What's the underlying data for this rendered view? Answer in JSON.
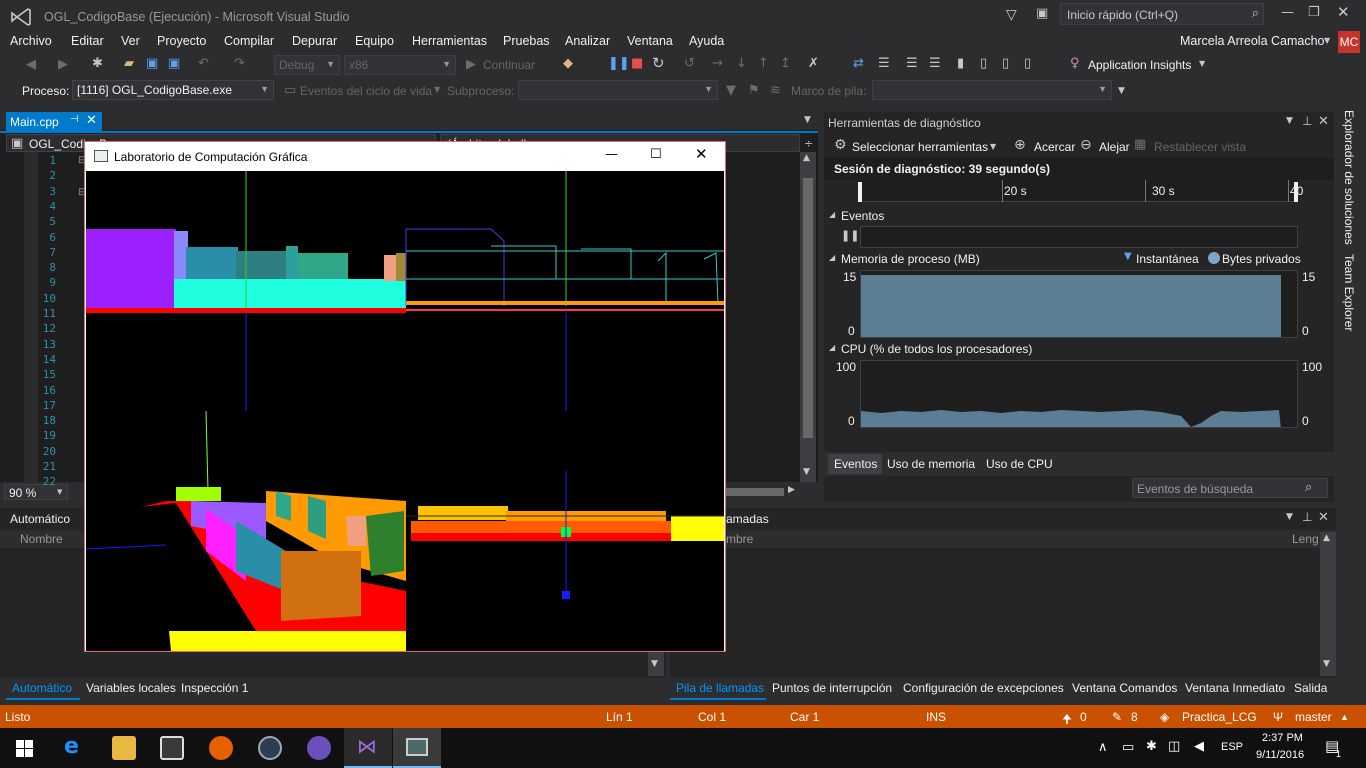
{
  "window": {
    "title": "OGL_CodigoBase (Ejecución) - Microsoft Visual Studio",
    "quick_launch": "Inicio rápido (Ctrl+Q)",
    "user": "Marcela Arreola Camacho",
    "user_initials": "MC"
  },
  "menu": [
    "Archivo",
    "Editar",
    "Ver",
    "Proyecto",
    "Compilar",
    "Depurar",
    "Equipo",
    "Herramientas",
    "Pruebas",
    "Analizar",
    "Ventana",
    "Ayuda"
  ],
  "toolbar": {
    "config": "Debug",
    "platform": "x86",
    "continue": "Continuar",
    "app_insights": "Application Insights"
  },
  "debug_location": {
    "process_label": "Proceso:",
    "process_value": "[1116] OGL_CodigoBase.exe",
    "lifecycle": "Eventos del ciclo de vida",
    "thread_label": "Subproceso:",
    "stack_label": "Marco de pila:"
  },
  "editor": {
    "tab": "Main.cpp",
    "scope": "OGL_CodigoB",
    "scope2": "(Ámbito global)",
    "line_numbers": [
      "1",
      "2",
      "3",
      "4",
      "5",
      "6",
      "7",
      "8",
      "9",
      "10",
      "11",
      "12",
      "13",
      "14",
      "15",
      "16",
      "17",
      "18",
      "19",
      "20",
      "21",
      "22"
    ],
    "zoom": "90 %"
  },
  "gl_window": {
    "title": "Laboratorio de Computación Gráfica"
  },
  "diagnostics": {
    "title": "Herramientas de diagnóstico",
    "select_tools": "Seleccionar herramientas",
    "zoom_in": "Acercar",
    "zoom_out": "Alejar",
    "reset_view": "Restablecer vista",
    "session": "Sesión de diagnóstico: 39 segundo(s)",
    "ruler": [
      "20 s",
      "30 s",
      "40"
    ],
    "events_label": "Eventos",
    "memory_label": "Memoria de proceso (MB)",
    "legend_snapshot": "Instantánea",
    "legend_private": "Bytes privados",
    "memory_axis": {
      "max": "15",
      "min": "0"
    },
    "cpu_label": "CPU (% de todos los procesadores)",
    "cpu_axis": {
      "max": "100",
      "min": "0"
    },
    "tabs": [
      "Eventos",
      "Uso de memoria",
      "Uso de CPU"
    ],
    "search_placeholder": "Eventos de búsqueda"
  },
  "autos": {
    "title": "Automático",
    "col_name": "Nombre"
  },
  "callstack": {
    "title": "Pila de llamadas",
    "title_visible": "amadas",
    "col_name": "mbre",
    "col_lang": "Leng"
  },
  "bottom_tabs_left": [
    "Automático",
    "Variables locales",
    "Inspección 1"
  ],
  "bottom_tabs_right": [
    "Pila de llamadas",
    "Puntos de interrupción",
    "Configuración de excepciones",
    "Ventana Comandos",
    "Ventana Inmediato",
    "Salida"
  ],
  "side_tabs": [
    "Explorador de soluciones",
    "Team Explorer"
  ],
  "status": {
    "state": "Listo",
    "line": "Lín 1",
    "col": "Col 1",
    "car": "Car 1",
    "mode": "INS",
    "up": "0",
    "edits": "8",
    "repo": "Practica_LCG",
    "branch": "master"
  },
  "taskbar": {
    "lang": "ESP",
    "time": "2:37 PM",
    "date": "9/11/2016",
    "notifications": "1"
  },
  "colors": {
    "accent": "#007acc",
    "status_bar": "#ca5100",
    "chart_fill": "#5b7e95"
  }
}
